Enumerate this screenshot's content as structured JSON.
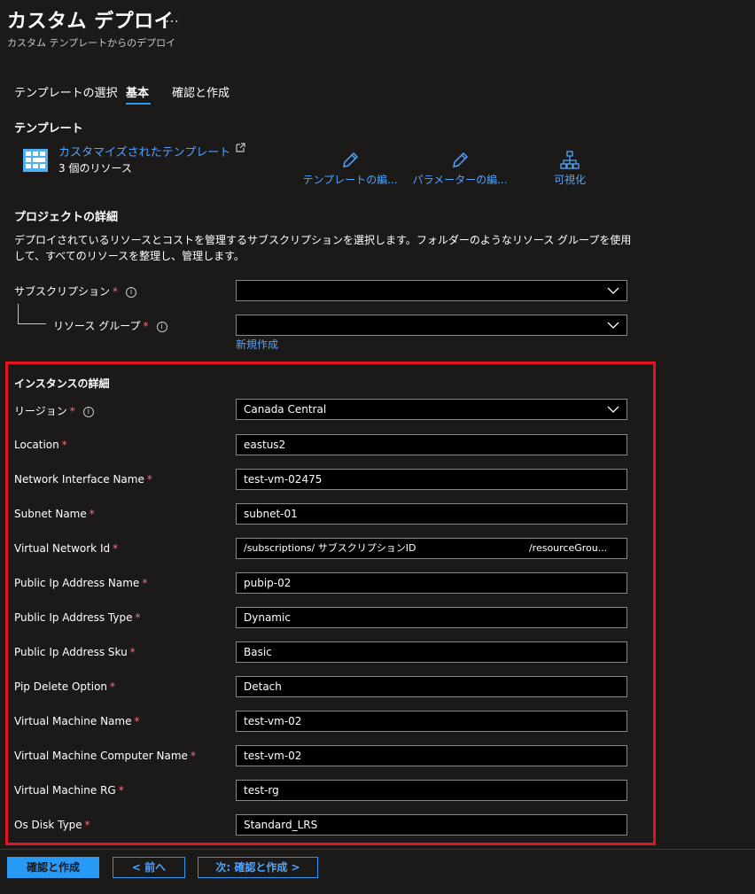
{
  "header": {
    "title": "カスタム デプロイ",
    "more": "…",
    "subtitle": "カスタム テンプレートからのデプロイ"
  },
  "tabs": [
    {
      "label": "テンプレートの選択"
    },
    {
      "label": "基本",
      "active": true
    },
    {
      "label": "確認と作成"
    }
  ],
  "template": {
    "heading": "テンプレート",
    "link": "カスタマイズされたテンプレート",
    "count": "3 個のリソース",
    "tools": [
      {
        "label": "テンプレートの編...",
        "icon": "pencil-icon"
      },
      {
        "label": "パラメーターの編...",
        "icon": "pencil-icon"
      },
      {
        "label": "可視化",
        "icon": "hierarchy-icon"
      }
    ]
  },
  "project": {
    "heading": "プロジェクトの詳細",
    "description": "デプロイされているリソースとコストを管理するサブスクリプションを選択します。フォルダーのようなリソース グループを使用して、すべてのリソースを整理し、管理します。",
    "subscription_label": "サブスクリプション",
    "subscription_value": "",
    "resource_group_label": "リソース グループ",
    "resource_group_value": "",
    "create_new": "新規作成"
  },
  "instance": {
    "heading": "インスタンスの詳細",
    "region_label": "リージョン",
    "region_value": "Canada Central",
    "fields": [
      {
        "label": "Location",
        "value": "eastus2"
      },
      {
        "label": "Network Interface Name",
        "value": "test-vm-02475"
      },
      {
        "label": "Subnet Name",
        "value": "subnet-01"
      },
      {
        "label": "Virtual Network Id",
        "value_prefix": "/subscriptions/",
        "value_mid": "サブスクリプションID",
        "value_suffix": "/resourceGrou..."
      },
      {
        "label": "Public Ip Address Name",
        "value": "pubip-02"
      },
      {
        "label": "Public Ip Address Type",
        "value": "Dynamic"
      },
      {
        "label": "Public Ip Address Sku",
        "value": "Basic"
      },
      {
        "label": "Pip Delete Option",
        "value": "Detach"
      },
      {
        "label": "Virtual Machine Name",
        "value": "test-vm-02"
      },
      {
        "label": "Virtual Machine Computer Name",
        "value": "test-vm-02"
      },
      {
        "label": "Virtual Machine RG",
        "value": "test-rg"
      },
      {
        "label": "Os Disk Type",
        "value": "Standard_LRS"
      }
    ]
  },
  "required_mark": "*",
  "info_glyph": "i",
  "footer": {
    "review_create": "確認と作成",
    "previous": "< 前へ",
    "next": "次: 確認と作成 >"
  },
  "colors": {
    "accent": "#2899f5",
    "required": "#f1707b",
    "highlight": "#e81123",
    "background": "#1b1a19"
  }
}
